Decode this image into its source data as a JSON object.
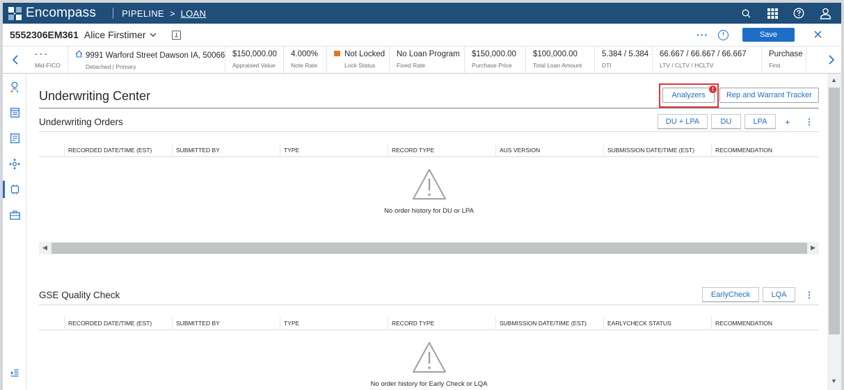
{
  "topbar": {
    "app_name": "Encompass",
    "crumb_pipeline": "PIPELINE",
    "crumb_arrow": ">",
    "crumb_loan": "LOAN",
    "icons": [
      "search-icon",
      "apps-grid-icon",
      "help-icon",
      "user-icon"
    ]
  },
  "loan": {
    "number": "5552306EM361",
    "borrower": "Alice Firstimer",
    "more": "···",
    "save_label": "Save"
  },
  "summary": [
    {
      "value": "- - -",
      "label": "Mid-FICO"
    },
    {
      "value": "9991 Warford Street Dawson IA, 50066",
      "label": "Detached | Primary"
    },
    {
      "value": "$150,000.00",
      "label": "Appraised Value"
    },
    {
      "value": "4.000%",
      "label": "Note Rate"
    },
    {
      "value": "Not Locked",
      "label": "Lock Status"
    },
    {
      "value": "No Loan Program",
      "label": "Fixed Rate"
    },
    {
      "value": "$150,000.00",
      "label": "Purchase Price"
    },
    {
      "value": "$100,000.00",
      "label": "Total Loan Amount"
    },
    {
      "value": "5.384 / 5.384",
      "label": "DTI"
    },
    {
      "value": "66.667 / 66.667 / 66.667",
      "label": "LTV / CLTV / HCLTV"
    },
    {
      "value": "Purchase",
      "label": "First"
    }
  ],
  "page": {
    "title": "Underwriting Center",
    "analyzers_label": "Analyzers",
    "analyzers_badge": "!",
    "rep_warrant_label": "Rep and Warrant Tracker"
  },
  "orders": {
    "title": "Underwriting Orders",
    "buttons": [
      "DU + LPA",
      "DU",
      "LPA"
    ],
    "plus": "+",
    "columns": [
      "RECORDED DATE/TIME (EST)",
      "SUBMITTED BY",
      "TYPE",
      "RECORD TYPE",
      "AUS VERSION",
      "SUBMISSION DATE/TIME (EST)",
      "RECOMMENDATION"
    ],
    "empty_message": "No order history for DU or LPA"
  },
  "gse": {
    "title": "GSE Quality Check",
    "buttons": [
      "EarlyCheck",
      "LQA"
    ],
    "columns": [
      "RECORDED DATE/TIME (EST)",
      "SUBMITTED BY",
      "TYPE",
      "RECORD TYPE",
      "SUBMISSION DATE/TIME (EST)",
      "EARLYCHECK STATUS",
      "RECOMMENDATION"
    ],
    "empty_message": "No order history for Early Check or LQA"
  },
  "rail": [
    "profile-icon",
    "forms-icon",
    "documents-icon",
    "services-icon",
    "underwriting-icon",
    "toolbox-icon",
    "expand-icon"
  ],
  "colors": {
    "topbar": "#1e4e79",
    "accent": "#1e6ec8",
    "highlight": "#d9363e",
    "lock": "#e0762b"
  }
}
